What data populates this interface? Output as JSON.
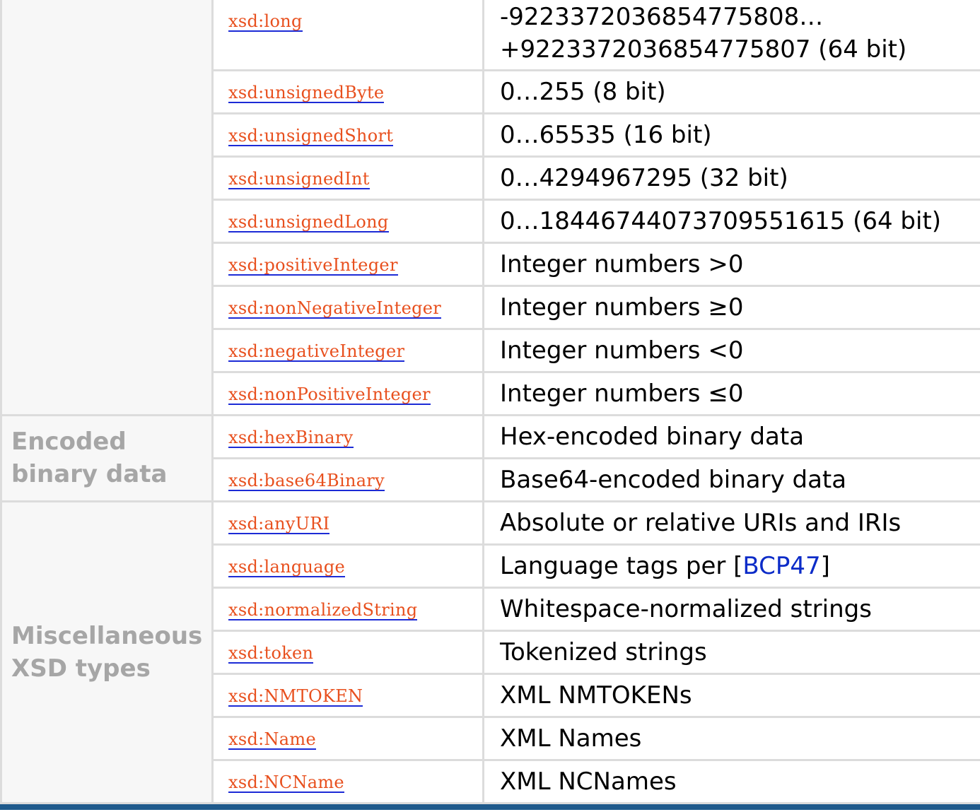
{
  "groups": {
    "encoded": {
      "line1": "Encoded",
      "line2": "binary data"
    },
    "misc": {
      "line1": "Miscellaneous",
      "line2": "XSD types"
    }
  },
  "rows": [
    {
      "type": "xsd:long",
      "desc_line1": "-9223372036854775808…",
      "desc_line2": "+9223372036854775807 (64 bit)"
    },
    {
      "type": "xsd:unsignedByte",
      "desc": "0…255 (8 bit)"
    },
    {
      "type": "xsd:unsignedShort",
      "desc": "0…65535 (16 bit)"
    },
    {
      "type": "xsd:unsignedInt",
      "desc": "0…4294967295 (32 bit)"
    },
    {
      "type": "xsd:unsignedLong",
      "desc": "0…18446744073709551615 (64 bit)"
    },
    {
      "type": "xsd:positiveInteger",
      "desc": "Integer numbers >0"
    },
    {
      "type": "xsd:nonNegativeInteger",
      "desc": "Integer numbers ≥0"
    },
    {
      "type": "xsd:negativeInteger",
      "desc": "Integer numbers <0"
    },
    {
      "type": "xsd:nonPositiveInteger",
      "desc": "Integer numbers ≤0"
    },
    {
      "type": "xsd:hexBinary",
      "desc": "Hex-encoded binary data"
    },
    {
      "type": "xsd:base64Binary",
      "desc": "Base64-encoded binary data"
    },
    {
      "type": "xsd:anyURI",
      "desc": "Absolute or relative URIs and IRIs"
    },
    {
      "type": "xsd:language",
      "desc_prefix": "Language tags per [",
      "desc_link": "BCP47",
      "desc_suffix": "]"
    },
    {
      "type": "xsd:normalizedString",
      "desc": "Whitespace-normalized strings"
    },
    {
      "type": "xsd:token",
      "desc": "Tokenized strings"
    },
    {
      "type": "xsd:NMTOKEN",
      "desc": "XML NMTOKENs"
    },
    {
      "type": "xsd:Name",
      "desc": "XML Names"
    },
    {
      "type": "xsd:NCName",
      "desc": "XML NCNames"
    }
  ],
  "colors": {
    "type_link_text": "#e8501e",
    "type_link_underline": "#1c2bd6",
    "ref_link": "#0c2cc8",
    "group_text": "#a6a6a6",
    "grid": "#dcdcdc",
    "bottom_rule": "#1f5a8c"
  }
}
